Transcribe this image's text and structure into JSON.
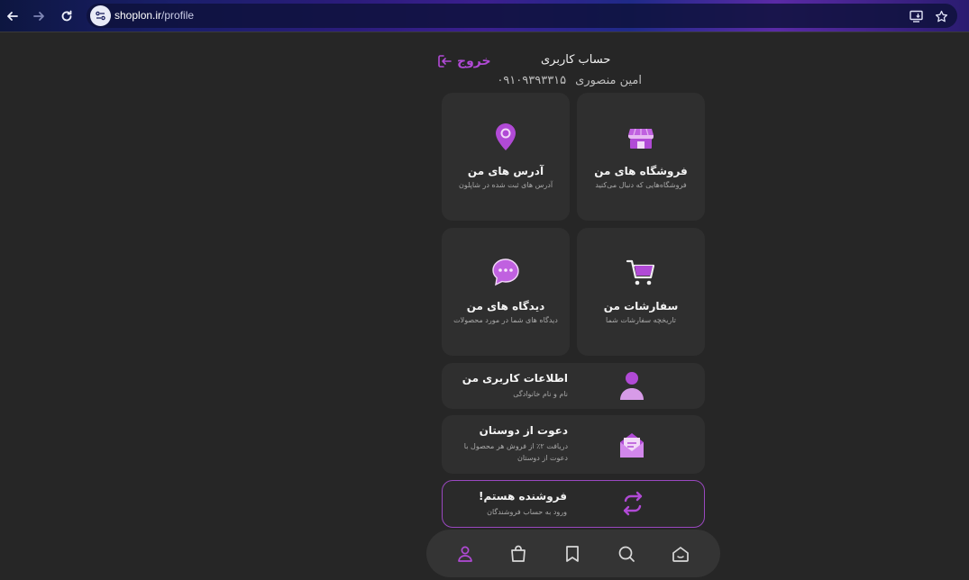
{
  "browser": {
    "url_host": "shoplon.ir",
    "url_path": "/profile",
    "icons": [
      "back-arrow-icon",
      "forward-arrow-icon",
      "reload-icon",
      "site-settings-icon",
      "install-app-icon",
      "bookmark-star-icon"
    ]
  },
  "header": {
    "title": "حساب کاربری",
    "logout_label": "خروج",
    "user_name": "امین منصوری",
    "phone": "۰۹۱۰۹۳۹۳۳۱۵"
  },
  "tiles": [
    {
      "title": "فروشگاه های من",
      "subtitle": "فروشگاه‌هایی که دنبال می‌کنید",
      "icon": "shop-icon"
    },
    {
      "title": "آدرس های من",
      "subtitle": "آدرس های ثبت شده در شاپلون",
      "icon": "location-pin-icon"
    },
    {
      "title": "سفارشات من",
      "subtitle": "تاریخچه سفارشات شما",
      "icon": "cart-icon"
    },
    {
      "title": "دیدگاه های من",
      "subtitle": "دیدگاه های شما در مورد محصولات",
      "icon": "chat-bubble-icon"
    }
  ],
  "rows": {
    "profile": {
      "title": "اطلاعات کاربری من",
      "subtitle": "نام و نام خانوادگی",
      "icon": "user-icon"
    },
    "invite": {
      "title": "دعوت از دوستان",
      "subtitle_line1": "دریافت ۲٪ از فروش هر محصول با",
      "subtitle_line2": "دعوت از دوستان",
      "icon": "envelope-icon"
    },
    "seller": {
      "title": "فروشنده هستم!",
      "subtitle": "ورود به حساب فروشندگان",
      "icon": "switch-arrows-icon"
    }
  },
  "bottom_nav": [
    "profile-icon",
    "bag-icon",
    "bookmark-icon",
    "search-icon",
    "home-icon"
  ],
  "colors": {
    "accent": "#b14ad6",
    "page_bg": "#262626",
    "card_bg": "#2f2f2f"
  }
}
